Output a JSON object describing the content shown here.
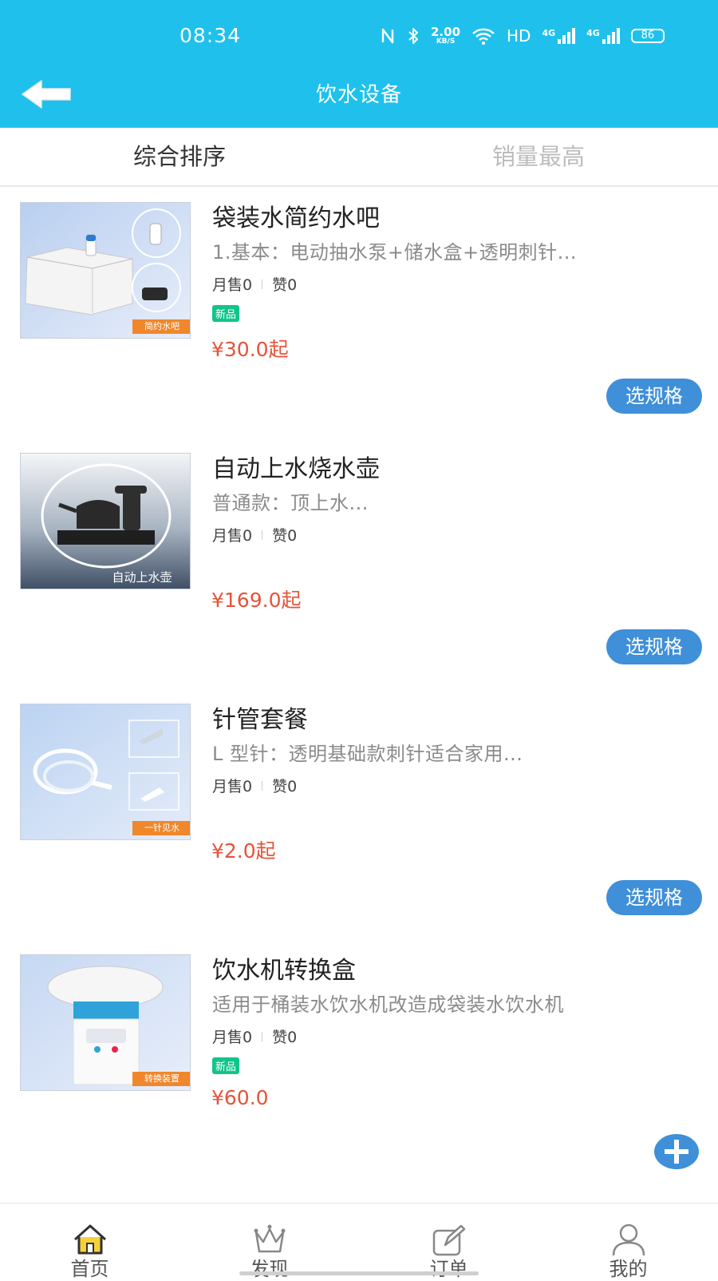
{
  "status_bar": {
    "time": "08:34",
    "net_speed_value": "2.00",
    "net_speed_unit": "KB/S",
    "hd": "HD",
    "signal1": "4G",
    "signal2": "4G",
    "battery": "86"
  },
  "header": {
    "title": "饮水设备",
    "background": "#1fc1ec"
  },
  "sort_tabs": [
    {
      "label": "综合排序",
      "active": true
    },
    {
      "label": "销量最高",
      "active": false
    }
  ],
  "products": [
    {
      "name": "袋装水简约水吧",
      "description": "1.基本：电动抽水泵+储水盒+透明刺针...",
      "monthly_sales": "月售0",
      "likes": "赞0",
      "badge": "新品",
      "price": "¥30.0起",
      "image_label": "简约水吧",
      "action": "选规格"
    },
    {
      "name": "自动上水烧水壶",
      "description": "普通款：顶上水...",
      "monthly_sales": "月售0",
      "likes": "赞0",
      "price": "¥169.0起",
      "image_label": "自动上水壶",
      "action": "选规格"
    },
    {
      "name": "针管套餐",
      "description": "L 型针：透明基础款刺针适合家用...",
      "monthly_sales": "月售0",
      "likes": "赞0",
      "price": "¥2.0起",
      "image_label": "一针见水",
      "action": "选规格"
    },
    {
      "name": "饮水机转换盒",
      "description": "适用于桶装水饮水机改造成袋装水饮水机",
      "monthly_sales": "月售0",
      "likes": "赞0",
      "badge": "新品",
      "price": "¥60.0",
      "image_label": "转换装置",
      "action_icon": "plus-circle-icon"
    }
  ],
  "bottom_nav": [
    {
      "label": "首页",
      "icon": "home-icon",
      "active": true
    },
    {
      "label": "发现",
      "icon": "crown-icon",
      "active": false
    },
    {
      "label": "订单",
      "icon": "edit-note-icon",
      "active": false
    },
    {
      "label": "我的",
      "icon": "user-icon",
      "active": false
    }
  ],
  "colors": {
    "accent": "#1fc1ec",
    "price": "#e6533a",
    "button": "#3f8fd9",
    "badge": "#12c48b",
    "image_tag": "#f0872b"
  }
}
